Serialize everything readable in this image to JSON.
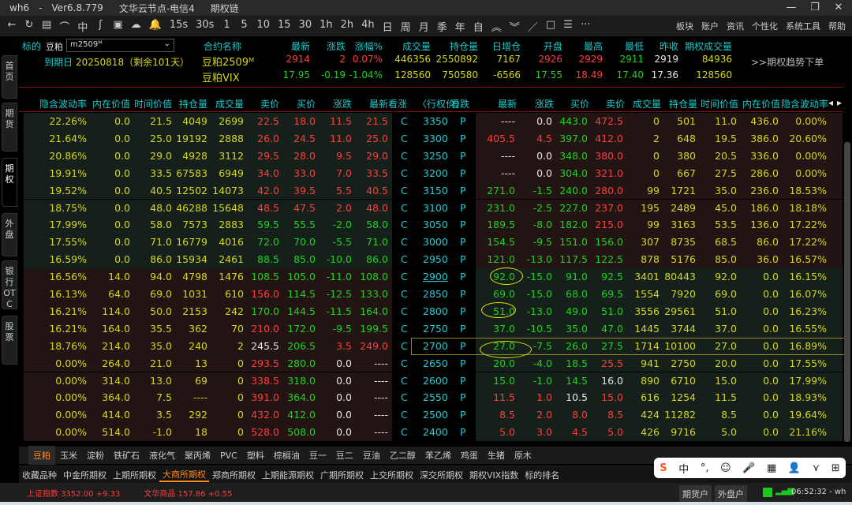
{
  "title": {
    "app": "wh6",
    "sep": "-",
    "version": "Ver6.8.779",
    "node": "文华云节点-电信4",
    "page": "期权链"
  },
  "window": {
    "minimize": "—",
    "maximize": "❐",
    "close": "✕"
  },
  "toolbar": {
    "tools": [
      "←",
      "↻",
      "▤",
      "⌒",
      "中",
      "ʃ",
      "▣",
      "☁",
      "🔔",
      "15s",
      "30s",
      "1",
      "5",
      "10",
      "15",
      "30",
      "1h",
      "2h",
      "4h",
      "日",
      "周",
      "月",
      "季",
      "年",
      "自",
      "︽",
      "︾",
      "／",
      "□",
      "☰",
      "···"
    ],
    "menu": [
      "板块",
      "账户",
      "资讯",
      "个性化",
      "系统工具",
      "帮助"
    ]
  },
  "info": {
    "underlying_label": "标的",
    "underlying_name": "豆粕",
    "contract_select": "m2509ᴹ",
    "expiry_label": "到期日",
    "expiry": "20250818（剩余101天）",
    "headers": [
      "合约名称",
      "最新",
      "涨跌",
      "涨幅%",
      "成交量",
      "持仓量",
      "日增仓",
      "开盘",
      "最高",
      "最低",
      "昨收",
      "期权成交量"
    ],
    "rows": [
      {
        "name": "豆粕2509ᴹ",
        "last": "2914",
        "chg": "2",
        "pct": "0.07%",
        "vol": "446356",
        "oi": "2550892",
        "doi": "7167",
        "open": "2926",
        "high": "2929",
        "low": "2911",
        "prev": "2919",
        "optvol": "84936"
      },
      {
        "name": "豆粕VIX",
        "last": "17.95",
        "chg": "-0.19",
        "pct": "-1.04%",
        "vol": "128560",
        "oi": "750580",
        "doi": "-6566",
        "open": "17.55",
        "high": "18.49",
        "low": "17.40",
        "prev": "17.36",
        "optvol": "128560"
      }
    ],
    "trend_link": ">>期权趋势下单"
  },
  "left_tabs": [
    "首页",
    "期货",
    "期权",
    "外盘",
    "银行OTC",
    "股票"
  ],
  "table": {
    "call_headers": [
      "隐含波动率",
      "内在价值",
      "时间价值",
      "持仓量",
      "成交量",
      "卖价",
      "买价",
      "涨跌",
      "最新"
    ],
    "center_headers": [
      "看涨",
      "〈行权价〉",
      "看跌"
    ],
    "put_headers": [
      "最新",
      "涨跌",
      "买价",
      "卖价",
      "成交量",
      "持仓量",
      "时间价值",
      "内在价值",
      "隐含波动率"
    ],
    "nav": [
      "◂",
      "▸"
    ],
    "rows": [
      {
        "strike": "3350",
        "call": [
          "22.26%",
          "0.0",
          "21.5",
          "4049",
          "2699",
          "22.5",
          "18.0",
          "11.5",
          "21.5"
        ],
        "cc": "yyyyyrrrr",
        "put": [
          "----",
          "0.0",
          "443.0",
          "472.5",
          "0",
          "501",
          "11.0",
          "436.0",
          "0.00%"
        ],
        "pc": "wwgryyyyy"
      },
      {
        "strike": "3300",
        "call": [
          "21.64%",
          "0.0",
          "25.0",
          "19192",
          "2888",
          "26.0",
          "24.5",
          "11.0",
          "25.0"
        ],
        "cc": "yyyyyrrrr",
        "put": [
          "405.5",
          "4.5",
          "397.0",
          "412.0",
          "2",
          "648",
          "19.5",
          "386.0",
          "20.60%"
        ],
        "pc": "rrgryyyyy"
      },
      {
        "strike": "3250",
        "call": [
          "20.86%",
          "0.0",
          "29.0",
          "4928",
          "3112",
          "29.5",
          "28.0",
          "9.5",
          "29.0"
        ],
        "cc": "yyyyyrrrr",
        "put": [
          "----",
          "0.0",
          "348.0",
          "380.0",
          "0",
          "380",
          "20.5",
          "336.0",
          "0.00%"
        ],
        "pc": "wwgryyyyy"
      },
      {
        "strike": "3200",
        "call": [
          "19.91%",
          "0.0",
          "33.5",
          "67583",
          "6949",
          "34.0",
          "33.0",
          "7.0",
          "33.5"
        ],
        "cc": "yyyyyrrrr",
        "put": [
          "----",
          "0.0",
          "304.0",
          "321.0",
          "0",
          "667",
          "27.5",
          "286.0",
          "0.00%"
        ],
        "pc": "wwgryyyyy"
      },
      {
        "strike": "3150",
        "call": [
          "19.52%",
          "0.0",
          "40.5",
          "12502",
          "14073",
          "42.0",
          "39.5",
          "5.5",
          "40.5"
        ],
        "cc": "yyyyyrrrr",
        "put": [
          "271.0",
          "-1.5",
          "240.0",
          "280.0",
          "99",
          "1721",
          "35.0",
          "236.0",
          "18.53%"
        ],
        "pc": "gggryyyyy"
      },
      {
        "strike": "3100",
        "call": [
          "18.75%",
          "0.0",
          "48.0",
          "46288",
          "15648",
          "48.5",
          "47.5",
          "2.0",
          "48.0"
        ],
        "cc": "yyyyyrrrr",
        "put": [
          "231.0",
          "-2.5",
          "227.0",
          "237.0",
          "195",
          "2489",
          "45.0",
          "186.0",
          "18.18%"
        ],
        "pc": "gggryyyyy"
      },
      {
        "strike": "3050",
        "call": [
          "17.99%",
          "0.0",
          "58.0",
          "7573",
          "2883",
          "59.5",
          "55.5",
          "-2.0",
          "58.0"
        ],
        "cc": "yyyyygggg",
        "put": [
          "189.5",
          "-8.0",
          "182.0",
          "215.0",
          "99",
          "3163",
          "53.5",
          "136.0",
          "17.22%"
        ],
        "pc": "gggryyyyy"
      },
      {
        "strike": "3000",
        "call": [
          "17.55%",
          "0.0",
          "71.0",
          "16779",
          "4016",
          "72.0",
          "70.0",
          "-5.5",
          "71.0"
        ],
        "cc": "yyyyygggg",
        "put": [
          "154.5",
          "-9.5",
          "151.0",
          "156.0",
          "307",
          "8735",
          "68.5",
          "86.0",
          "17.22%"
        ],
        "pc": "ggggyyyyy"
      },
      {
        "strike": "2950",
        "call": [
          "16.59%",
          "0.0",
          "86.0",
          "15934",
          "2461",
          "88.5",
          "85.0",
          "-10.0",
          "86.0"
        ],
        "cc": "yyyyygggg",
        "put": [
          "121.0",
          "-13.0",
          "117.5",
          "122.5",
          "878",
          "5176",
          "85.0",
          "36.0",
          "16.57%"
        ],
        "pc": "ggggyyyyy"
      },
      {
        "strike": "2900",
        "call": [
          "16.56%",
          "14.0",
          "94.0",
          "4798",
          "1476",
          "108.5",
          "105.0",
          "-11.0",
          "108.0"
        ],
        "cc": "yyyyygggg",
        "put": [
          "92.0",
          "-15.0",
          "91.0",
          "92.5",
          "3401",
          "80443",
          "92.0",
          "0.0",
          "16.15%"
        ],
        "pc": "ggggyyyyy"
      },
      {
        "strike": "2850",
        "call": [
          "16.13%",
          "64.0",
          "69.0",
          "1031",
          "610",
          "156.0",
          "114.5",
          "-12.5",
          "133.0"
        ],
        "cc": "yyyyyrggg",
        "put": [
          "69.0",
          "-15.0",
          "68.0",
          "69.5",
          "1554",
          "7920",
          "69.0",
          "0.0",
          "16.07%"
        ],
        "pc": "ggggyyyyy"
      },
      {
        "strike": "2800",
        "call": [
          "16.21%",
          "114.0",
          "50.0",
          "2153",
          "242",
          "170.0",
          "144.5",
          "-11.5",
          "164.0"
        ],
        "cc": "yyyyygggg",
        "put": [
          "51.0",
          "-13.0",
          "49.0",
          "51.0",
          "3556",
          "29561",
          "51.0",
          "0.0",
          "16.23%"
        ],
        "pc": "ggggyyyyy"
      },
      {
        "strike": "2750",
        "call": [
          "16.21%",
          "164.0",
          "35.5",
          "362",
          "70",
          "210.0",
          "172.0",
          "-9.5",
          "199.5"
        ],
        "cc": "yyyyyrggg",
        "put": [
          "37.0",
          "-10.5",
          "35.0",
          "47.0",
          "1445",
          "3744",
          "37.0",
          "0.0",
          "16.55%"
        ],
        "pc": "ggggyyyyy"
      },
      {
        "strike": "2700",
        "call": [
          "18.76%",
          "214.0",
          "35.0",
          "240",
          "2",
          "245.5",
          "206.5",
          "3.5",
          "249.0"
        ],
        "cc": "yyyyywgrr",
        "put": [
          "27.0",
          "-7.5",
          "26.0",
          "27.5",
          "1714",
          "10100",
          "27.0",
          "0.0",
          "16.89%"
        ],
        "pc": "ggggyyyyy"
      },
      {
        "strike": "2650",
        "call": [
          "0.00%",
          "264.0",
          "21.0",
          "13",
          "0",
          "293.5",
          "280.0",
          "0.0",
          "----"
        ],
        "cc": "yyyyyrgww",
        "put": [
          "20.0",
          "-4.0",
          "18.5",
          "25.5",
          "941",
          "2750",
          "20.0",
          "0.0",
          "17.55%"
        ],
        "pc": "gggryyyyy"
      },
      {
        "strike": "2600",
        "call": [
          "0.00%",
          "314.0",
          "13.0",
          "69",
          "0",
          "338.5",
          "318.0",
          "0.0",
          "----"
        ],
        "cc": "yyyyyrgww",
        "put": [
          "15.0",
          "-1.0",
          "14.5",
          "16.0",
          "890",
          "6710",
          "15.0",
          "0.0",
          "17.99%"
        ],
        "pc": "gggwyyyyy"
      },
      {
        "strike": "2550",
        "call": [
          "0.00%",
          "364.0",
          "7.5",
          "----",
          "0",
          "391.0",
          "364.0",
          "0.0",
          "----"
        ],
        "cc": "yyyyyrgww",
        "put": [
          "11.5",
          "1.0",
          "10.5",
          "15.0",
          "616",
          "1254",
          "11.5",
          "0.0",
          "18.93%"
        ],
        "pc": "rrwryyyyy"
      },
      {
        "strike": "2500",
        "call": [
          "0.00%",
          "414.0",
          "3.5",
          "292",
          "0",
          "432.0",
          "412.0",
          "0.0",
          "----"
        ],
        "cc": "yyyyyrgww",
        "put": [
          "8.5",
          "2.0",
          "8.0",
          "8.5",
          "424",
          "11282",
          "8.5",
          "0.0",
          "19.64%"
        ],
        "pc": "rrrryyyyy"
      },
      {
        "strike": "2400",
        "call": [
          "0.00%",
          "514.0",
          "-1.0",
          "18",
          "0",
          "528.0",
          "508.0",
          "0.0",
          "----"
        ],
        "cc": "yyyyyrgww",
        "put": [
          "5.0",
          "3.0",
          "4.5",
          "5.0",
          "426",
          "9716",
          "5.0",
          "0.0",
          "21.16%"
        ],
        "pc": "rrrryyyyy"
      }
    ],
    "call_label": "C",
    "put_label": "P",
    "atm_split_index": 9,
    "selected_strike": "2700",
    "underlined_strike": "2900"
  },
  "product_tabs": [
    "豆粕",
    "玉米",
    "淀粉",
    "铁矿石",
    "液化气",
    "聚丙烯",
    "PVC",
    "塑料",
    "棕榈油",
    "豆一",
    "豆二",
    "豆油",
    "乙二醇",
    "苯乙烯",
    "鸡蛋",
    "生猪",
    "原木"
  ],
  "product_active": "豆粕",
  "exchange_tabs": [
    "收藏品种",
    "中金所期权",
    "上期所期权",
    "大商所期权",
    "郑商所期权",
    "上期能源期权",
    "广期所期权",
    "上交所期权",
    "深交所期权",
    "期权VIX指数",
    "标的排名"
  ],
  "exchange_active": "大商所期权",
  "status": {
    "idx1": "上证指数  3352.00  +9.33",
    "idx2": "文华商品  157.86  +0.55",
    "btn1": "期货户",
    "btn2": "外盘户",
    "time": "06:52:32 - wh"
  },
  "ime": [
    "S",
    "中",
    "°,",
    "☺",
    "🎤",
    "▦",
    "👤",
    "⋎",
    "⊞"
  ]
}
